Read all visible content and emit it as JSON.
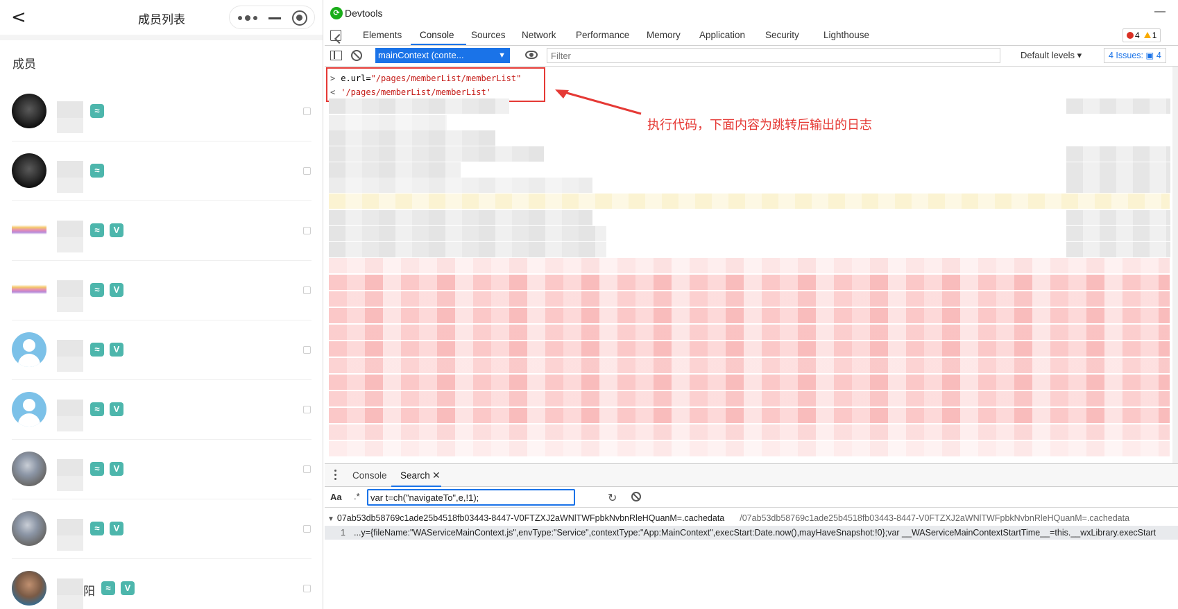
{
  "phone": {
    "nav_title": "成员列表",
    "back_glyph": "<",
    "section_title": "成员",
    "members": [
      {
        "avatar": "dark",
        "name": "",
        "badges": [
          "grad-icon"
        ]
      },
      {
        "avatar": "dark",
        "name": "",
        "badges": [
          "grad-icon"
        ]
      },
      {
        "avatar": "sunset",
        "name": "",
        "badges": [
          "grad-icon",
          "verified-icon"
        ]
      },
      {
        "avatar": "sunset",
        "name": "",
        "badges": [
          "grad-icon",
          "verified-icon"
        ]
      },
      {
        "avatar": "default",
        "name": "",
        "badges": [
          "grad-icon",
          "verified-icon"
        ]
      },
      {
        "avatar": "default",
        "name": "",
        "badges": [
          "grad-icon",
          "verified-icon"
        ]
      },
      {
        "avatar": "robot",
        "name": "",
        "badges": [
          "grad-icon",
          "verified-icon"
        ]
      },
      {
        "avatar": "robot",
        "name": "",
        "badges": [
          "grad-icon",
          "verified-icon"
        ]
      },
      {
        "avatar": "person",
        "name": "阳",
        "badges": [
          "grad-icon",
          "verified-icon"
        ]
      }
    ],
    "badge_colors": {
      "badge": "#4db6ac"
    }
  },
  "devtools": {
    "window_title": "Devtools",
    "minimize_glyph": "—",
    "tabs": [
      "Elements",
      "Console",
      "Sources",
      "Network",
      "Performance",
      "Memory",
      "Application",
      "Security",
      "Lighthouse"
    ],
    "active_tab": "Console",
    "error_count": "4",
    "warning_count": "1",
    "toolbar": {
      "context": "mainContext (conte...",
      "filter_placeholder": "Filter",
      "levels": "Default levels",
      "issues": "4 Issues:",
      "issues_count": "4"
    },
    "console": {
      "input_prompt": ">",
      "input_code_prefix": "e.url=",
      "input_code_string": "\"/pages/memberList/memberList\"",
      "output_prompt": "<",
      "output_value": "'/pages/memberList/memberList'",
      "annotation": "执行代码，下面内容为跳转后输出的日志"
    },
    "drawer": {
      "tabs": [
        "Console",
        "Search"
      ],
      "active_tab": "Search",
      "close_glyph": "✕",
      "search_case_label": "Aa",
      "search_regex_label": ".*",
      "search_value": "var t=ch(\"navigateTo\",e,!1);",
      "result_file": "07ab53db58769c1ade25b4518fb03443-8447-V0FTZXJ2aWNlTWFpbkNvbnRleHQuanM=.cachedata",
      "result_path": "/07ab53db58769c1ade25b4518fb03443-8447-V0FTZXJ2aWNlTWFpbkNvbnRleHQuanM=.cachedata",
      "result_line_number": "1",
      "result_line_text": "...y={fileName:\"WAServiceMainContext.js\",envType:\"Service\",contextType:\"App:MainContext\",execStart:Date.now(),mayHaveSnapshot:!0};var __WAServiceMainContextStartTime__=this.__wxLibrary.execStart"
    },
    "colors": {
      "accent": "#1a73e8",
      "annotation": "#e53935",
      "error": "#d93025",
      "warning": "#f9ab00"
    }
  }
}
